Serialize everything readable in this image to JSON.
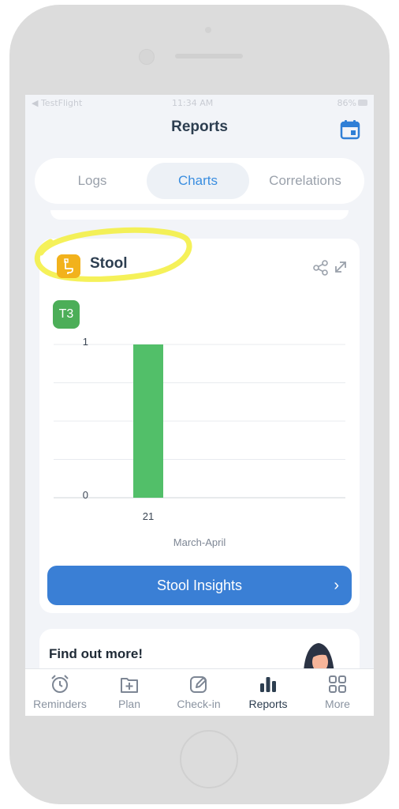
{
  "status_bar": {
    "carrier": "◀ TestFlight",
    "time": "11:34 AM",
    "battery": "86%"
  },
  "header": {
    "title": "Reports"
  },
  "tabs": [
    {
      "label": "Logs",
      "active": false
    },
    {
      "label": "Charts",
      "active": true
    },
    {
      "label": "Correlations",
      "active": false
    }
  ],
  "card": {
    "title": "Stool",
    "icon": "toilet-icon",
    "badge": "T3",
    "insights_button": "Stool Insights",
    "insights_chevron": "›"
  },
  "chart_data": {
    "type": "bar",
    "categories": [
      "21"
    ],
    "values": [
      1
    ],
    "xlabel": "March-April",
    "ylabel": "",
    "ylim": [
      0,
      1
    ],
    "y_ticks": [
      "0",
      "1"
    ],
    "grid": true,
    "bar_color": "#52bf69"
  },
  "more_card": {
    "label": "Find out more!"
  },
  "bottom_nav": [
    {
      "label": "Reminders",
      "icon": "alarm-clock-icon",
      "active": false
    },
    {
      "label": "Plan",
      "icon": "plan-add-icon",
      "active": false
    },
    {
      "label": "Check-in",
      "icon": "pencil-square-icon",
      "active": false
    },
    {
      "label": "Reports",
      "icon": "bar-chart-icon",
      "active": true
    },
    {
      "label": "More",
      "icon": "grid-icon",
      "active": false
    }
  ],
  "colors": {
    "accent": "#3a7fd5",
    "highlight": "#f3ef3c",
    "bar": "#52bf69",
    "badge": "#4cae58",
    "stool_icon": "#f2b21c"
  }
}
